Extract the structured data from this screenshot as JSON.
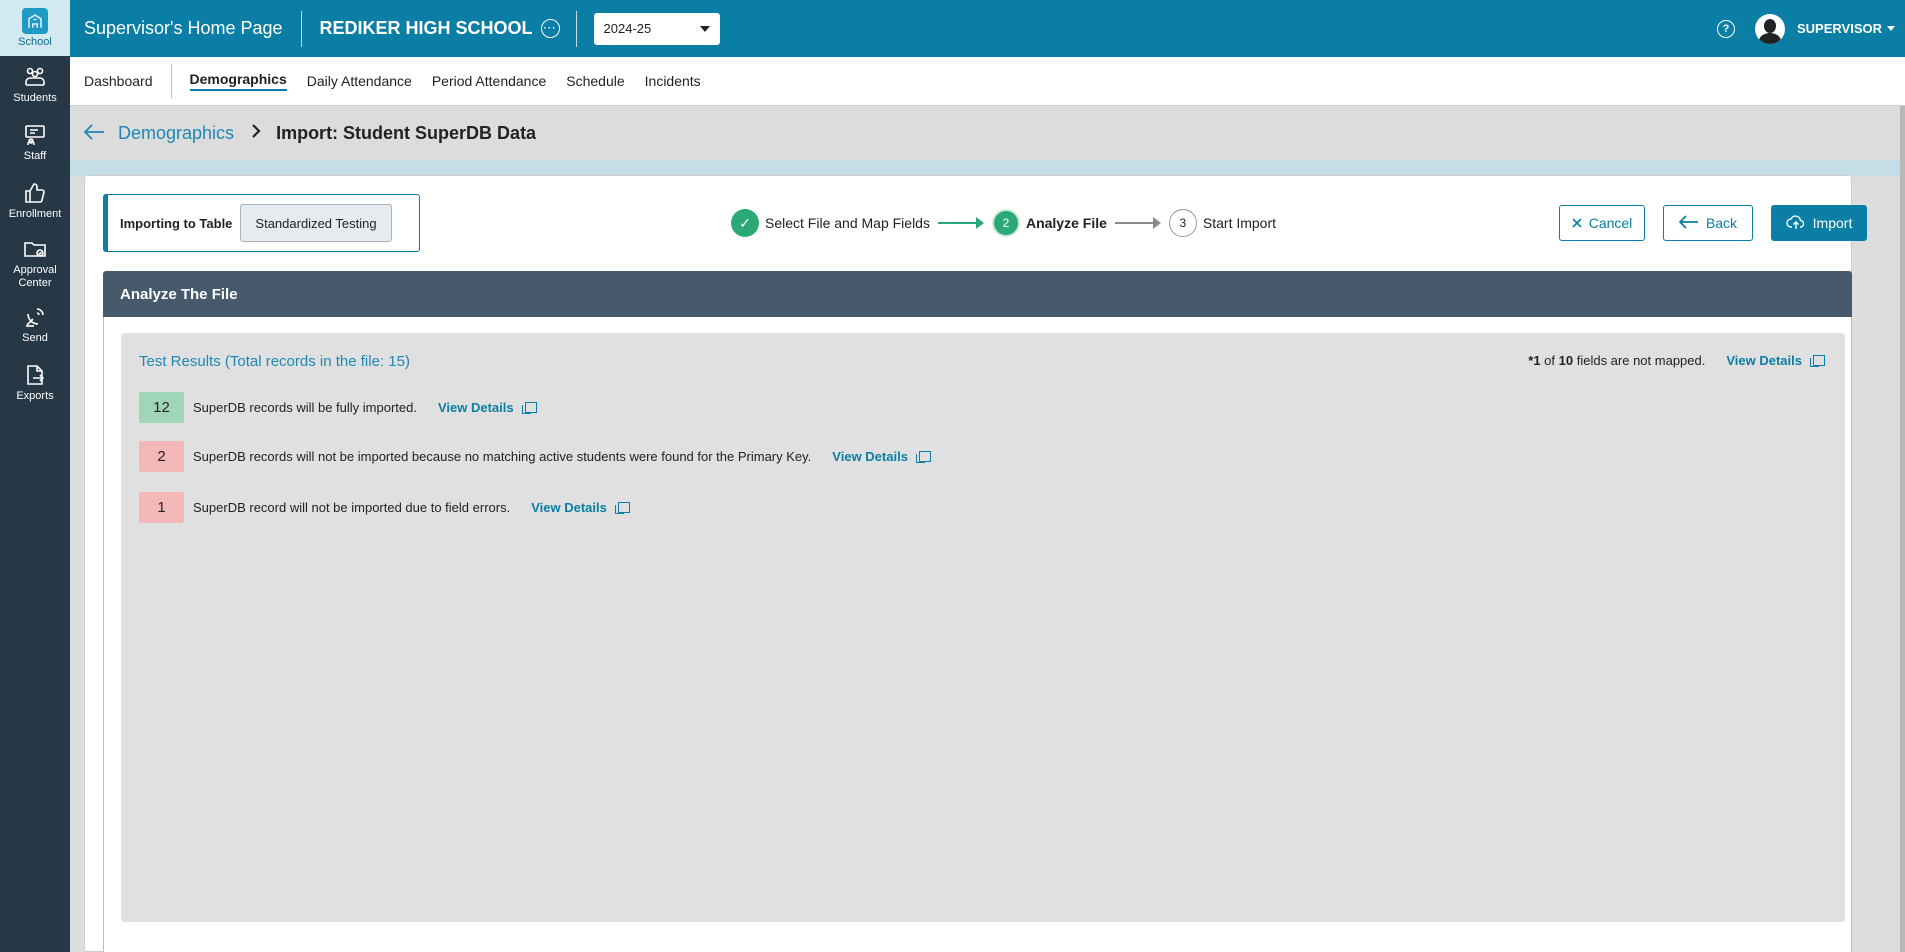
{
  "sidebar": {
    "items": [
      {
        "label": "School",
        "icon": "school-icon"
      },
      {
        "label": "Students",
        "icon": "students-icon"
      },
      {
        "label": "Staff",
        "icon": "staff-icon"
      },
      {
        "label": "Enrollment",
        "icon": "thumbs-up-icon"
      },
      {
        "label": "Approval Center",
        "icon": "folder-icon"
      },
      {
        "label": "Send",
        "icon": "satellite-icon"
      },
      {
        "label": "Exports",
        "icon": "export-icon"
      }
    ]
  },
  "header": {
    "home_title": "Supervisor's Home Page",
    "school_name": "REDIKER HIGH SCHOOL",
    "year": "2024-25",
    "user": "SUPERVISOR",
    "help": "?"
  },
  "nav": {
    "tabs": [
      {
        "label": "Dashboard"
      },
      {
        "label": "Demographics"
      },
      {
        "label": "Daily Attendance"
      },
      {
        "label": "Period Attendance"
      },
      {
        "label": "Schedule"
      },
      {
        "label": "Incidents"
      }
    ]
  },
  "breadcrumb": {
    "parent": "Demographics",
    "current": "Import: Student SuperDB Data"
  },
  "import": {
    "table_label": "Importing to Table",
    "table_value": "Standardized Testing"
  },
  "stepper": {
    "steps": [
      {
        "number": "✓",
        "label": "Select File and Map Fields",
        "state": "done"
      },
      {
        "number": "2",
        "label": "Analyze File",
        "state": "current"
      },
      {
        "number": "3",
        "label": "Start Import",
        "state": "todo"
      }
    ]
  },
  "actions": {
    "cancel": "Cancel",
    "back": "Back",
    "import": "Import"
  },
  "section": {
    "title": "Analyze The File"
  },
  "results": {
    "title": "Test Results (Total records in the file: 15)",
    "unmapped_prefix": "*",
    "unmapped_count": "1",
    "unmapped_of": " of ",
    "unmapped_total": "10",
    "unmapped_suffix": " fields are not mapped.",
    "view_details": "View Details",
    "rows": [
      {
        "count": "12",
        "text": "SuperDB records will be fully imported.",
        "status": "success",
        "color": "#9fd6b7"
      },
      {
        "count": "2",
        "text": "SuperDB records will not be imported because no matching active students were found for the Primary Key.",
        "status": "error",
        "color": "#f5b8b8"
      },
      {
        "count": "1",
        "text": "SuperDB record will not be imported due to field errors.",
        "status": "error",
        "color": "#f5b8b8"
      }
    ]
  },
  "colors": {
    "header": "#0a7ea4",
    "sidebar": "#263746",
    "section_head": "#465a6c",
    "success": "#2aa876"
  }
}
